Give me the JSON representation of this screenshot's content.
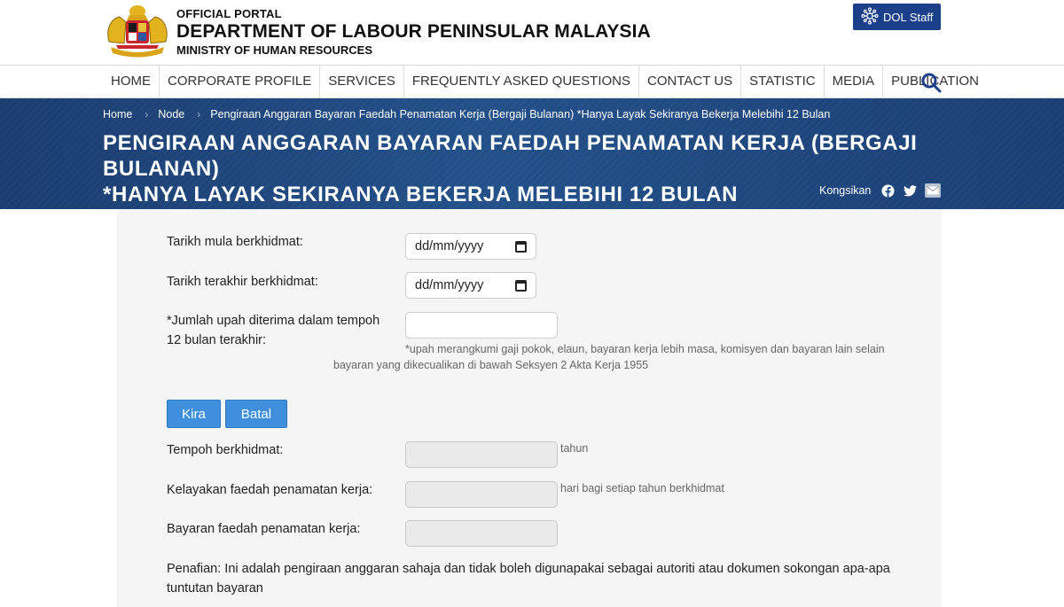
{
  "header": {
    "line1": "OFFICIAL PORTAL",
    "line2": "DEPARTMENT OF LABOUR PENINSULAR MALAYSIA",
    "line3": "MINISTRY OF HUMAN RESOURCES",
    "staff_button": "DOL Staff"
  },
  "nav": {
    "items": [
      "HOME",
      "CORPORATE PROFILE",
      "SERVICES",
      "FREQUENTLY ASKED QUESTIONS",
      "CONTACT US",
      "STATISTIC",
      "MEDIA",
      "PUBLICATION"
    ]
  },
  "breadcrumb": {
    "items": [
      "Home",
      "Node",
      "Pengiraan Anggaran Bayaran Faedah Penamatan Kerja (Bergaji Bulanan) *Hanya Layak Sekiranya Bekerja Melebihi 12 Bulan"
    ]
  },
  "page": {
    "title_line1": "PENGIRAAN ANGGARAN BAYARAN FAEDAH PENAMATAN KERJA (BERGAJI BULANAN)",
    "title_line2": "*HANYA LAYAK SEKIRANYA BEKERJA MELEBIHI 12 BULAN",
    "share_label": "Kongsikan"
  },
  "form": {
    "start_label": "Tarikh mula berkhidmat:",
    "start_placeholder": "dd/mm/yyyy",
    "end_label": "Tarikh terakhir berkhidmat:",
    "end_placeholder": "dd/mm/yyyy",
    "wage_label_1": "*Jumlah upah diterima dalam tempoh",
    "wage_label_2": "12 bulan terakhir:",
    "wage_value": "",
    "wage_help_1": "*upah merangkumi gaji pokok, elaun, bayaran kerja lebih masa, komisyen dan bayaran lain selain",
    "wage_help_2": "bayaran yang dikecualikan di bawah Seksyen 2 Akta Kerja 1955",
    "calc_button": "Kira",
    "cancel_button": "Batal",
    "tenure_label": "Tempoh berkhidmat:",
    "tenure_unit": "tahun",
    "eligibility_label": "Kelayakan faedah penamatan kerja:",
    "eligibility_unit": "hari bagi setiap tahun berkhidmat",
    "payment_label": "Bayaran faedah penamatan kerja:",
    "disclaimer_1": "Penafian: Ini adalah pengiraan anggaran sahaja dan tidak boleh digunapakai sebagai autoriti atau dokumen sokongan apa-apa",
    "disclaimer_2": "tuntutan bayaran"
  },
  "colors": {
    "banner": "#235089",
    "staff_button": "#1c3f8a",
    "action_button": "#3f8fdc",
    "panel": "#f5f5f5"
  }
}
